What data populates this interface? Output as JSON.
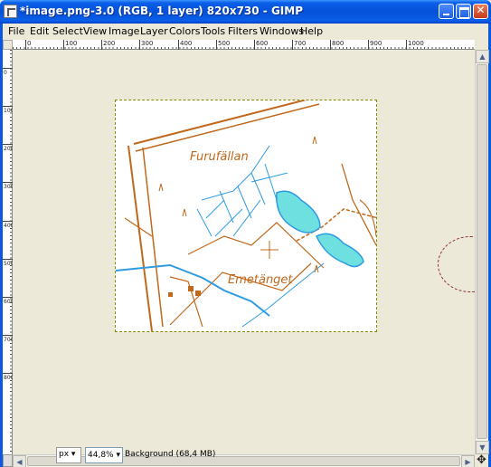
{
  "window": {
    "title": "*image.png-3.0 (RGB, 1 layer) 820x730 - GIMP",
    "close_glyph": "✕"
  },
  "menubar": {
    "items": [
      {
        "label": "File"
      },
      {
        "label": "Edit"
      },
      {
        "label": "Select"
      },
      {
        "label": "View"
      },
      {
        "label": "Image"
      },
      {
        "label": "Layer"
      },
      {
        "label": "Colors"
      },
      {
        "label": "Tools"
      },
      {
        "label": "Filters"
      },
      {
        "label": "Windows"
      },
      {
        "label": "Help"
      }
    ]
  },
  "ruler": {
    "top_labels": [
      "0",
      "100",
      "200",
      "300",
      "400",
      "500",
      "600",
      "700",
      "800",
      "900",
      "1000"
    ],
    "left_labels": [
      "0",
      "100",
      "200",
      "300",
      "400",
      "500",
      "600",
      "700",
      "800"
    ]
  },
  "map": {
    "label_north": "Furufällan",
    "label_south": "Emetänget",
    "colors": {
      "road": "#C0681B",
      "water": "#2E9BE0",
      "lake": "#6FE0E0"
    }
  },
  "statusbar": {
    "unit": "px",
    "unit_arrow": "▾",
    "zoom": "44,8%",
    "zoom_arrow": "▾",
    "layer_info": "Background (68,4 MB)"
  },
  "icons": {
    "navigate": "✥",
    "scroll_up": "▲",
    "scroll_down": "▼",
    "scroll_left": "◀",
    "scroll_right": "▶"
  }
}
